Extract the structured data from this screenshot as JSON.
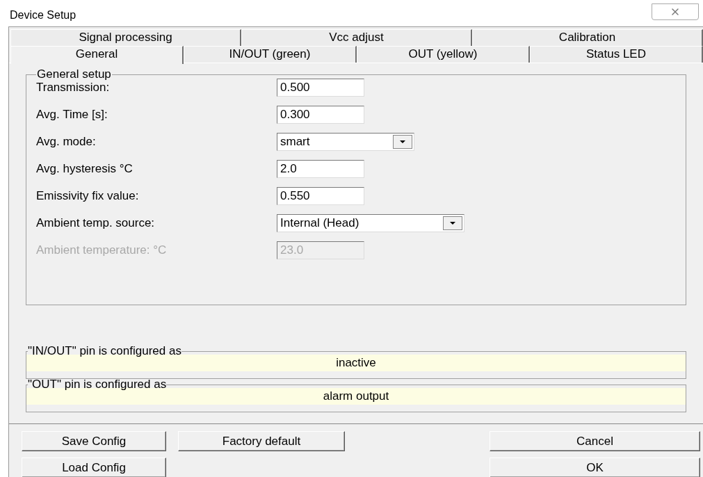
{
  "window": {
    "title": "Device Setup"
  },
  "tab_rows": [
    [
      {
        "label": "Signal processing",
        "selected": false
      },
      {
        "label": "Vcc adjust",
        "selected": false
      },
      {
        "label": "Calibration",
        "selected": false
      }
    ],
    [
      {
        "label": "General",
        "selected": true
      },
      {
        "label": "IN/OUT (green)",
        "selected": false
      },
      {
        "label": "OUT (yellow)",
        "selected": false
      },
      {
        "label": "Status LED",
        "selected": false
      }
    ]
  ],
  "general_setup": {
    "title": "General setup",
    "fields": [
      {
        "label": "Transmission:",
        "kind": "text",
        "value": "0.500",
        "disabled": false
      },
      {
        "label": "Avg. Time [s]:",
        "kind": "text",
        "value": "0.300",
        "disabled": false
      },
      {
        "label": "Avg. mode:",
        "kind": "dropdown",
        "value": "smart",
        "disabled": false
      },
      {
        "label": "Avg. hysteresis °C",
        "kind": "text",
        "value": "2.0",
        "disabled": false
      },
      {
        "label": "Emissivity fix value:",
        "kind": "text",
        "value": "0.550",
        "disabled": false
      },
      {
        "label": "Ambient temp. source:",
        "kind": "dropdown_wide",
        "value": "Internal (Head)",
        "disabled": false
      },
      {
        "label": "Ambient temperature: °C",
        "kind": "text",
        "value": "23.0",
        "disabled": true
      }
    ]
  },
  "pin_info": [
    {
      "title": "\"IN/OUT\" pin is configured as",
      "value": "inactive"
    },
    {
      "title": "\"OUT\" pin is configured as",
      "value": "alarm output"
    }
  ],
  "buttons_left": [
    [
      "Save Config",
      "Factory default"
    ],
    [
      "Load Config"
    ]
  ],
  "buttons_right": [
    "Cancel",
    "OK"
  ]
}
